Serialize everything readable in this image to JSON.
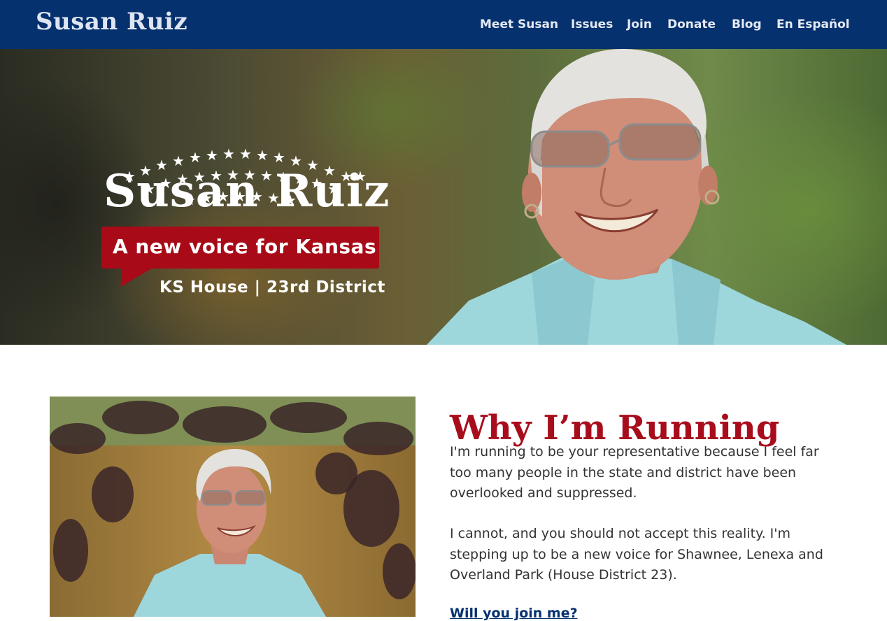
{
  "header": {
    "brand": "Susan Ruiz",
    "nav": [
      "Meet Susan",
      "Issues",
      "Join",
      "Donate",
      "Blog",
      "En Español"
    ]
  },
  "hero": {
    "name": "Susan Ruiz",
    "tagline": "A new voice for Kansas",
    "district": "KS House | 23rd District"
  },
  "main": {
    "title": "Why I’m Running",
    "paragraphs": [
      "I'm running to be your representative because I feel far too many people in the state and district have been overlooked and suppressed.",
      "I cannot, and you should not accept this reality.  I'm stepping up to be a new voice for Shawnee, Lenexa and Overland Park (House District 23)."
    ],
    "cta": "Will you join me?"
  },
  "colors": {
    "navy": "#06316f",
    "red": "#a80a18",
    "white": "#ffffff",
    "text": "#333333"
  }
}
